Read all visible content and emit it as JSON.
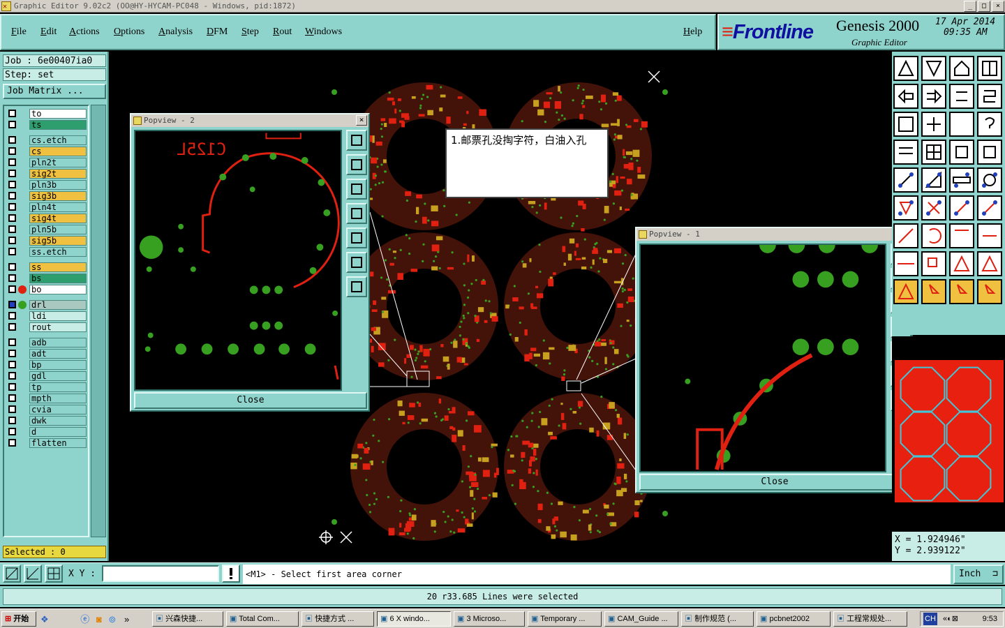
{
  "window": {
    "title": "Graphic Editor 9.02c2 (OO@HY-HYCAM-PC048 - Windows, pid:1872)"
  },
  "menu": {
    "file": "File",
    "edit": "Edit",
    "actions": "Actions",
    "options": "Options",
    "analysis": "Analysis",
    "dfm": "DFM",
    "step": "Step",
    "rout": "Rout",
    "windows": "Windows",
    "help": "Help"
  },
  "brand": {
    "logo": "Frontline",
    "product": "Genesis 2000",
    "subtitle": "Graphic Editor",
    "date": "17 Apr 2014",
    "time": "09:35 AM"
  },
  "job": {
    "job_label": "Job : 6e00407ia0",
    "step_label": "Step: set",
    "matrix_button": "Job Matrix ..."
  },
  "layers": [
    {
      "name": "to",
      "bg": "#ffffff"
    },
    {
      "name": "ts",
      "bg": "#2f9e6e"
    },
    {
      "name": "cs.etch",
      "bg": "#8fd4cc"
    },
    {
      "name": "cs",
      "bg": "#f0c040"
    },
    {
      "name": "pln2t",
      "bg": "#8fd4cc"
    },
    {
      "name": "sig2t",
      "bg": "#f0c040"
    },
    {
      "name": "pln3b",
      "bg": "#8fd4cc"
    },
    {
      "name": "sig3b",
      "bg": "#f0c040"
    },
    {
      "name": "pln4t",
      "bg": "#8fd4cc"
    },
    {
      "name": "sig4t",
      "bg": "#f0c040"
    },
    {
      "name": "pln5b",
      "bg": "#8fd4cc"
    },
    {
      "name": "sig5b",
      "bg": "#f0c040"
    },
    {
      "name": "ss.etch",
      "bg": "#8fd4cc"
    },
    {
      "name": "ss",
      "bg": "#f0c040"
    },
    {
      "name": "bs",
      "bg": "#2f9e6e"
    },
    {
      "name": "bo",
      "bg": "#ffffff"
    },
    {
      "name": "drl",
      "bg": "#a8c8c0"
    },
    {
      "name": "ldi",
      "bg": "#c8ece6"
    },
    {
      "name": "rout",
      "bg": "#c8ece6"
    },
    {
      "name": "adb",
      "bg": "#8fd4cc"
    },
    {
      "name": "adt",
      "bg": "#8fd4cc"
    },
    {
      "name": "bp",
      "bg": "#8fd4cc"
    },
    {
      "name": "gdl",
      "bg": "#8fd4cc"
    },
    {
      "name": "tp",
      "bg": "#8fd4cc"
    },
    {
      "name": "mpth",
      "bg": "#8fd4cc"
    },
    {
      "name": "cvia",
      "bg": "#8fd4cc"
    },
    {
      "name": "dwk",
      "bg": "#8fd4cc"
    },
    {
      "name": "d",
      "bg": "#8fd4cc"
    },
    {
      "name": "flatten",
      "bg": "#8fd4cc"
    }
  ],
  "selected_label": "Selected : 0",
  "coords": {
    "x": "X = 1.924946\"",
    "y": "Y = 2.939122\""
  },
  "command": {
    "xy_label": "X Y :",
    "xy_value": "",
    "prompt": "<M1> - Select first area corner",
    "unit": "Inch"
  },
  "status_message": "20 r33.685 Lines were selected",
  "popview2": {
    "title": "Popview - 2",
    "close_label": "Close",
    "board_text": "C125L"
  },
  "popview1": {
    "title": "Popview - 1",
    "close_label": "Close"
  },
  "note": "1.邮票孔没掏字符，白油入孔",
  "taskbar": {
    "start": "开始",
    "items": [
      "兴森快捷...",
      "Total Com...",
      "快捷方式 ...",
      "6 X windo...",
      "3 Microso...",
      "Temporary ...",
      "CAM_Guide ...",
      "制作规范 (...",
      "pcbnet2002",
      "工程常规处..."
    ],
    "tray_lang": "CH",
    "clock": "9:53"
  },
  "colors": {
    "panel": "#8fd4cc",
    "copper": "#e02010",
    "pad": "#38a020",
    "board": "#000000"
  }
}
